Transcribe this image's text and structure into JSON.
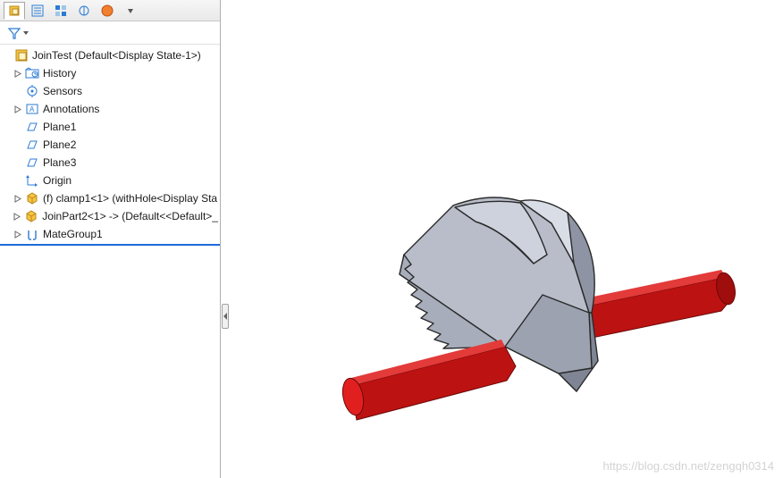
{
  "tree": {
    "root": {
      "label": "JoinTest  (Default<Display State-1>)"
    },
    "items": [
      {
        "label": "History"
      },
      {
        "label": "Sensors"
      },
      {
        "label": "Annotations"
      },
      {
        "label": "Plane1"
      },
      {
        "label": "Plane2"
      },
      {
        "label": "Plane3"
      },
      {
        "label": "Origin"
      },
      {
        "label": "(f) clamp1<1> (withHole<Display Sta"
      },
      {
        "label": "JoinPart2<1> -> (Default<<Default>_"
      },
      {
        "label": "MateGroup1"
      }
    ]
  },
  "watermark": "https://blog.csdn.net/zengqh0314",
  "icons": {
    "tab_assembly": "assembly-icon",
    "tab_config": "config-icon",
    "tab_tree2": "tree2-icon",
    "tab_display": "display-icon",
    "tab_other1": "other1-icon",
    "tab_other2": "other2-icon"
  }
}
